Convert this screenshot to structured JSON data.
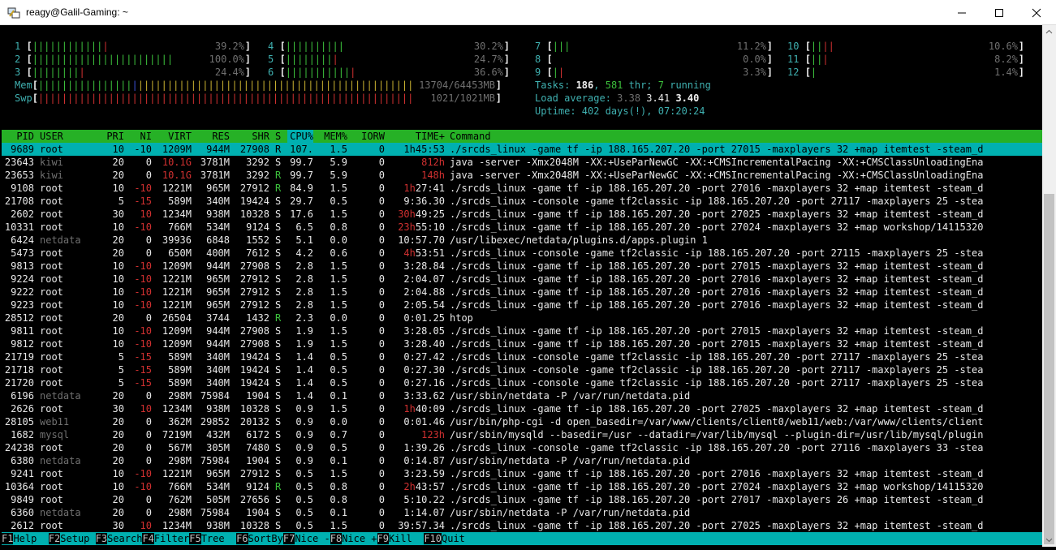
{
  "window": {
    "title": "reagy@Galil-Gaming: ~"
  },
  "meters": {
    "cpus": [
      {
        "id": "1",
        "bar": "||||||||||||",
        "bar_red": "|",
        "pct": "39.2%"
      },
      {
        "id": "2",
        "bar": "||||||||||||||||||||||||",
        "bar_red": "",
        "pct": "100.0%"
      },
      {
        "id": "3",
        "bar": "||||||||",
        "bar_red": "|",
        "pct": "24.4%"
      },
      {
        "id": "4",
        "bar": "||||||||||",
        "bar_red": "",
        "pct": "30.2%"
      },
      {
        "id": "5",
        "bar": "||||||||",
        "bar_red": "|",
        "pct": "24.7%"
      },
      {
        "id": "6",
        "bar": "|||||||||||",
        "bar_red": "|",
        "pct": "36.6%"
      },
      {
        "id": "7",
        "bar": "|||",
        "bar_red": "",
        "pct": "11.2%"
      },
      {
        "id": "8",
        "bar": "",
        "bar_red": "",
        "pct": "0.0%"
      },
      {
        "id": "9",
        "bar": "|",
        "bar_red": "|",
        "pct": "3.3%"
      },
      {
        "id": "10",
        "bar": "||",
        "bar_red": "||",
        "pct": "10.6%"
      },
      {
        "id": "11",
        "bar": "||",
        "bar_red": "|",
        "pct": "8.2%"
      },
      {
        "id": "12",
        "bar": "|",
        "bar_red": "",
        "pct": "1.4%"
      }
    ],
    "mem": {
      "label": "Mem",
      "value": "13704/64453MB"
    },
    "swp": {
      "label": "Swp",
      "value": "1021/1021MB"
    },
    "tasks_label": "Tasks: ",
    "tasks": "186",
    "thr": "581",
    "running": "7",
    "tasks_sep1": ", ",
    "tasks_sep2": " thr; ",
    "tasks_sep3": " running",
    "load_label": "Load average: ",
    "load1": "3.38",
    "load5": "3.41",
    "load15": "3.40",
    "uptime_label": "Uptime: ",
    "uptime": "402 days(!), 07:20:24"
  },
  "columns": [
    "PID",
    "USER",
    "PRI",
    "NI",
    "VIRT",
    "RES",
    "SHR",
    "S",
    "CPU%",
    "MEM%",
    "IORW",
    "TIME+",
    "Command"
  ],
  "processes": [
    {
      "pid": "9689",
      "user": "root",
      "pri": "10",
      "ni": "-10",
      "virt": "1209M",
      "res": "944M",
      "shr": "27908",
      "s": "R",
      "cpu": "107.",
      "mem": "1.5",
      "iorw": "0",
      "time_h": "1h",
      "time": "45:53",
      "cmd": "./srcds_linux -game tf -ip 188.165.207.20 -port 27015 -maxplayers 32 +map itemtest -steam_d"
    },
    {
      "pid": "23643",
      "user": "kiwi",
      "pri": "20",
      "ni": "0",
      "virt": "10.1G",
      "res": "3781M",
      "shr": "3292",
      "s": "S",
      "cpu": "99.7",
      "mem": "5.9",
      "iorw": "0",
      "time_h": "812h",
      "time": "",
      "cmd": "java -server -Xmx2048M -XX:+UseParNewGC -XX:+CMSIncrementalPacing -XX:+CMSClassUnloadingEna"
    },
    {
      "pid": "23653",
      "user": "kiwi",
      "pri": "20",
      "ni": "0",
      "virt": "10.1G",
      "res": "3781M",
      "shr": "3292",
      "s": "R",
      "cpu": "99.7",
      "mem": "5.9",
      "iorw": "0",
      "time_h": "148h",
      "time": "",
      "cmd": "java -server -Xmx2048M -XX:+UseParNewGC -XX:+CMSIncrementalPacing -XX:+CMSClassUnloadingEna"
    },
    {
      "pid": "9108",
      "user": "root",
      "pri": "10",
      "ni": "-10",
      "virt": "1221M",
      "res": "965M",
      "shr": "27912",
      "s": "R",
      "cpu": "84.9",
      "mem": "1.5",
      "iorw": "0",
      "time_h": "1h",
      "time": "27:41",
      "cmd": "./srcds_linux -game tf -ip 188.165.207.20 -port 27016 -maxplayers 32 +map itemtest -steam_d"
    },
    {
      "pid": "21708",
      "user": "root",
      "pri": "5",
      "ni": "-15",
      "virt": "589M",
      "res": "340M",
      "shr": "19424",
      "s": "S",
      "cpu": "29.7",
      "mem": "0.5",
      "iorw": "0",
      "time_h": "",
      "time": "9:36.30",
      "cmd": "./srcds_linux -console -game tf2classic -ip 188.165.207.20 -port 27117 -maxplayers 25 -stea"
    },
    {
      "pid": "2602",
      "user": "root",
      "pri": "30",
      "ni": "10",
      "virt": "1234M",
      "res": "938M",
      "shr": "10328",
      "s": "S",
      "cpu": "17.6",
      "mem": "1.5",
      "iorw": "0",
      "time_h": "30h",
      "time": "49:25",
      "cmd": "./srcds_linux -game tf -ip 188.165.207.20 -port 27025 -maxplayers 32 +map itemtest -steam_d"
    },
    {
      "pid": "10331",
      "user": "root",
      "pri": "10",
      "ni": "-10",
      "virt": "766M",
      "res": "534M",
      "shr": "9124",
      "s": "S",
      "cpu": "6.5",
      "mem": "0.8",
      "iorw": "0",
      "time_h": "23h",
      "time": "55:10",
      "cmd": "./srcds_linux -game tf -ip 188.165.207.20 -port 27024 -maxplayers 32 +map workshop/14115320"
    },
    {
      "pid": "6424",
      "user": "netdata",
      "pri": "20",
      "ni": "0",
      "virt": "39936",
      "res": "6848",
      "shr": "1552",
      "s": "S",
      "cpu": "5.1",
      "mem": "0.0",
      "iorw": "0",
      "time_h": "",
      "time": "10:57.70",
      "cmd": "/usr/libexec/netdata/plugins.d/apps.plugin 1"
    },
    {
      "pid": "5473",
      "user": "root",
      "pri": "20",
      "ni": "0",
      "virt": "650M",
      "res": "400M",
      "shr": "7612",
      "s": "S",
      "cpu": "4.2",
      "mem": "0.6",
      "iorw": "0",
      "time_h": "4h",
      "time": "53:51",
      "cmd": "./srcds_linux -console -game tf2classic -ip 188.165.207.20 -port 27115 -maxplayers 25 -stea"
    },
    {
      "pid": "9813",
      "user": "root",
      "pri": "10",
      "ni": "-10",
      "virt": "1209M",
      "res": "944M",
      "shr": "27908",
      "s": "S",
      "cpu": "2.8",
      "mem": "1.5",
      "iorw": "0",
      "time_h": "",
      "time": "3:28.84",
      "cmd": "./srcds_linux -game tf -ip 188.165.207.20 -port 27015 -maxplayers 32 +map itemtest -steam_d"
    },
    {
      "pid": "9224",
      "user": "root",
      "pri": "10",
      "ni": "-10",
      "virt": "1221M",
      "res": "965M",
      "shr": "27912",
      "s": "S",
      "cpu": "2.8",
      "mem": "1.5",
      "iorw": "0",
      "time_h": "",
      "time": "2:04.07",
      "cmd": "./srcds_linux -game tf -ip 188.165.207.20 -port 27016 -maxplayers 32 +map itemtest -steam_d"
    },
    {
      "pid": "9222",
      "user": "root",
      "pri": "10",
      "ni": "-10",
      "virt": "1221M",
      "res": "965M",
      "shr": "27912",
      "s": "S",
      "cpu": "2.8",
      "mem": "1.5",
      "iorw": "0",
      "time_h": "",
      "time": "2:04.88",
      "cmd": "./srcds_linux -game tf -ip 188.165.207.20 -port 27016 -maxplayers 32 +map itemtest -steam_d"
    },
    {
      "pid": "9223",
      "user": "root",
      "pri": "10",
      "ni": "-10",
      "virt": "1221M",
      "res": "965M",
      "shr": "27912",
      "s": "S",
      "cpu": "2.8",
      "mem": "1.5",
      "iorw": "0",
      "time_h": "",
      "time": "2:05.54",
      "cmd": "./srcds_linux -game tf -ip 188.165.207.20 -port 27016 -maxplayers 32 +map itemtest -steam_d"
    },
    {
      "pid": "28512",
      "user": "root",
      "pri": "20",
      "ni": "0",
      "virt": "26504",
      "res": "3744",
      "shr": "1432",
      "s": "R",
      "cpu": "2.3",
      "mem": "0.0",
      "iorw": "0",
      "time_h": "",
      "time": "0:01.25",
      "cmd": "htop"
    },
    {
      "pid": "9811",
      "user": "root",
      "pri": "10",
      "ni": "-10",
      "virt": "1209M",
      "res": "944M",
      "shr": "27908",
      "s": "S",
      "cpu": "1.9",
      "mem": "1.5",
      "iorw": "0",
      "time_h": "",
      "time": "3:28.05",
      "cmd": "./srcds_linux -game tf -ip 188.165.207.20 -port 27015 -maxplayers 32 +map itemtest -steam_d"
    },
    {
      "pid": "9812",
      "user": "root",
      "pri": "10",
      "ni": "-10",
      "virt": "1209M",
      "res": "944M",
      "shr": "27908",
      "s": "S",
      "cpu": "1.9",
      "mem": "1.5",
      "iorw": "0",
      "time_h": "",
      "time": "3:28.40",
      "cmd": "./srcds_linux -game tf -ip 188.165.207.20 -port 27015 -maxplayers 32 +map itemtest -steam_d"
    },
    {
      "pid": "21719",
      "user": "root",
      "pri": "5",
      "ni": "-15",
      "virt": "589M",
      "res": "340M",
      "shr": "19424",
      "s": "S",
      "cpu": "1.4",
      "mem": "0.5",
      "iorw": "0",
      "time_h": "",
      "time": "0:27.42",
      "cmd": "./srcds_linux -console -game tf2classic -ip 188.165.207.20 -port 27117 -maxplayers 25 -stea"
    },
    {
      "pid": "21718",
      "user": "root",
      "pri": "5",
      "ni": "-15",
      "virt": "589M",
      "res": "340M",
      "shr": "19424",
      "s": "S",
      "cpu": "1.4",
      "mem": "0.5",
      "iorw": "0",
      "time_h": "",
      "time": "0:27.30",
      "cmd": "./srcds_linux -console -game tf2classic -ip 188.165.207.20 -port 27117 -maxplayers 25 -stea"
    },
    {
      "pid": "21720",
      "user": "root",
      "pri": "5",
      "ni": "-15",
      "virt": "589M",
      "res": "340M",
      "shr": "19424",
      "s": "S",
      "cpu": "1.4",
      "mem": "0.5",
      "iorw": "0",
      "time_h": "",
      "time": "0:27.16",
      "cmd": "./srcds_linux -console -game tf2classic -ip 188.165.207.20 -port 27117 -maxplayers 25 -stea"
    },
    {
      "pid": "6196",
      "user": "netdata",
      "pri": "20",
      "ni": "0",
      "virt": "298M",
      "res": "75984",
      "shr": "1904",
      "s": "S",
      "cpu": "1.4",
      "mem": "0.1",
      "iorw": "0",
      "time_h": "",
      "time": "3:33.62",
      "cmd": "/usr/sbin/netdata -P /var/run/netdata.pid"
    },
    {
      "pid": "2626",
      "user": "root",
      "pri": "30",
      "ni": "10",
      "virt": "1234M",
      "res": "938M",
      "shr": "10328",
      "s": "S",
      "cpu": "0.9",
      "mem": "1.5",
      "iorw": "0",
      "time_h": "1h",
      "time": "40:09",
      "cmd": "./srcds_linux -game tf -ip 188.165.207.20 -port 27025 -maxplayers 32 +map itemtest -steam_d"
    },
    {
      "pid": "28105",
      "user": "web11",
      "pri": "20",
      "ni": "0",
      "virt": "362M",
      "res": "29852",
      "shr": "20132",
      "s": "S",
      "cpu": "0.9",
      "mem": "0.0",
      "iorw": "0",
      "time_h": "",
      "time": "0:01.46",
      "cmd": "/usr/bin/php-cgi -d open_basedir=/var/www/clients/client0/web11/web:/var/www/clients/client"
    },
    {
      "pid": "1682",
      "user": "mysql",
      "pri": "20",
      "ni": "0",
      "virt": "7219M",
      "res": "432M",
      "shr": "6172",
      "s": "S",
      "cpu": "0.9",
      "mem": "0.7",
      "iorw": "0",
      "time_h": "123h",
      "time": "",
      "cmd": "/usr/sbin/mysqld --basedir=/usr --datadir=/var/lib/mysql --plugin-dir=/usr/lib/mysql/plugin"
    },
    {
      "pid": "24238",
      "user": "root",
      "pri": "20",
      "ni": "0",
      "virt": "567M",
      "res": "305M",
      "shr": "7480",
      "s": "S",
      "cpu": "0.9",
      "mem": "0.5",
      "iorw": "0",
      "time_h": "",
      "time": "1:39.26",
      "cmd": "./srcds_linux -console -game tf2classic -ip 188.165.207.20 -port 27116 -maxplayers 33 -stea"
    },
    {
      "pid": "6380",
      "user": "netdata",
      "pri": "20",
      "ni": "0",
      "virt": "298M",
      "res": "75984",
      "shr": "1904",
      "s": "S",
      "cpu": "0.9",
      "mem": "0.1",
      "iorw": "0",
      "time_h": "",
      "time": "0:14.87",
      "cmd": "/usr/sbin/netdata -P /var/run/netdata.pid"
    },
    {
      "pid": "9241",
      "user": "root",
      "pri": "10",
      "ni": "-10",
      "virt": "1221M",
      "res": "965M",
      "shr": "27912",
      "s": "S",
      "cpu": "0.5",
      "mem": "1.5",
      "iorw": "0",
      "time_h": "",
      "time": "3:23.59",
      "cmd": "./srcds_linux -game tf -ip 188.165.207.20 -port 27016 -maxplayers 32 +map itemtest -steam_d"
    },
    {
      "pid": "10364",
      "user": "root",
      "pri": "10",
      "ni": "-10",
      "virt": "766M",
      "res": "534M",
      "shr": "9124",
      "s": "R",
      "cpu": "0.5",
      "mem": "0.8",
      "iorw": "0",
      "time_h": "2h",
      "time": "43:57",
      "cmd": "./srcds_linux -game tf -ip 188.165.207.20 -port 27024 -maxplayers 32 +map workshop/14115320"
    },
    {
      "pid": "9849",
      "user": "root",
      "pri": "20",
      "ni": "0",
      "virt": "762M",
      "res": "505M",
      "shr": "27656",
      "s": "S",
      "cpu": "0.5",
      "mem": "0.8",
      "iorw": "0",
      "time_h": "",
      "time": "5:10.22",
      "cmd": "./srcds_linux -game tf -ip 188.165.207.20 -port 27017 -maxplayers 26 +map itemtest -steam_d"
    },
    {
      "pid": "6360",
      "user": "netdata",
      "pri": "20",
      "ni": "0",
      "virt": "298M",
      "res": "75984",
      "shr": "1904",
      "s": "S",
      "cpu": "0.5",
      "mem": "0.1",
      "iorw": "0",
      "time_h": "",
      "time": "1:14.07",
      "cmd": "/usr/sbin/netdata -P /var/run/netdata.pid"
    },
    {
      "pid": "2612",
      "user": "root",
      "pri": "30",
      "ni": "10",
      "virt": "1234M",
      "res": "938M",
      "shr": "10328",
      "s": "S",
      "cpu": "0.5",
      "mem": "1.5",
      "iorw": "0",
      "time_h": "",
      "time": "39:57.34",
      "cmd": "./srcds_linux -game tf -ip 188.165.207.20 -port 27025 -maxplayers 32 +map itemtest -steam_d"
    }
  ],
  "fkeys": [
    {
      "key": "F1",
      "label": "Help"
    },
    {
      "key": "F2",
      "label": "Setup"
    },
    {
      "key": "F3",
      "label": "Search"
    },
    {
      "key": "F4",
      "label": "Filter"
    },
    {
      "key": "F5",
      "label": "Tree"
    },
    {
      "key": "F6",
      "label": "SortBy"
    },
    {
      "key": "F7",
      "label": "Nice -"
    },
    {
      "key": "F8",
      "label": "Nice +"
    },
    {
      "key": "F9",
      "label": "Kill"
    },
    {
      "key": "F10",
      "label": "Quit"
    }
  ],
  "colors": {
    "header_bg": "#26b126",
    "selected_bg": "#00b0b0",
    "accent_cyan": "#3fb0b0"
  }
}
